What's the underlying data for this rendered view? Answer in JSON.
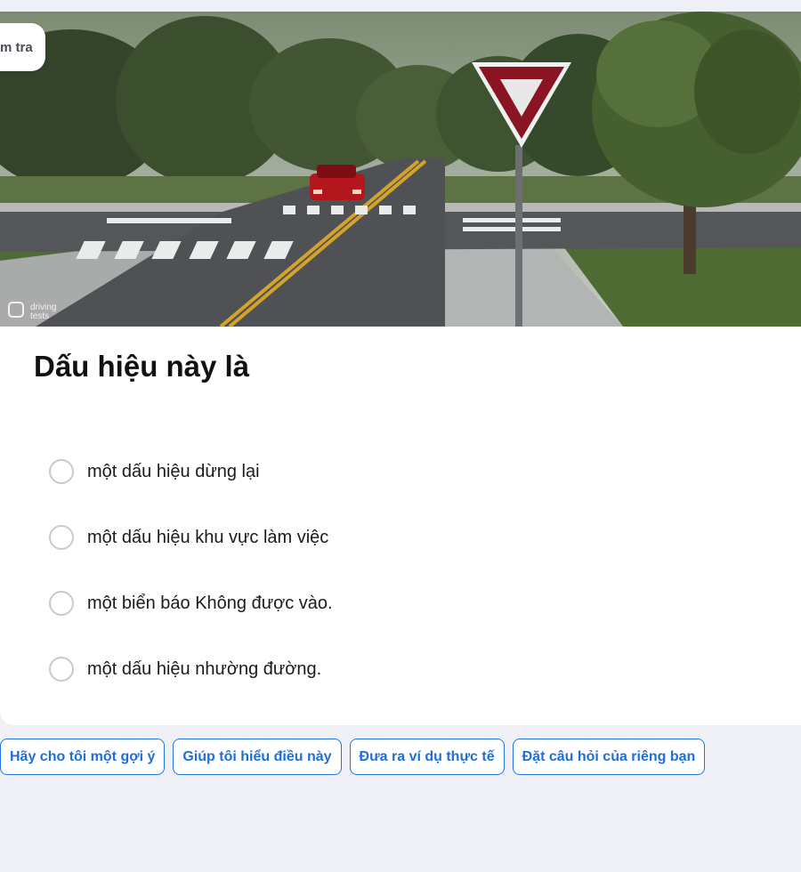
{
  "header": {
    "chip_label": "m tra"
  },
  "image": {
    "watermark_line1": "driving",
    "watermark_line2": "tests"
  },
  "question": {
    "text": "Dấu hiệu này là"
  },
  "options": [
    {
      "label": "một dấu hiệu dừng lại"
    },
    {
      "label": "một dấu hiệu khu vực làm việc"
    },
    {
      "label": "một biển báo Không được vào."
    },
    {
      "label": "một dấu hiệu nhường đường."
    }
  ],
  "suggestions": [
    {
      "label": "Hãy cho tôi một gợi ý"
    },
    {
      "label": "Giúp tôi hiểu điều này"
    },
    {
      "label": "Đưa ra ví dụ thực tế"
    },
    {
      "label": "Đặt câu hỏi của riêng bạn"
    }
  ],
  "colors": {
    "accent": "#1f74e0",
    "sign_red": "#8a1422",
    "background": "#eff0f5"
  }
}
